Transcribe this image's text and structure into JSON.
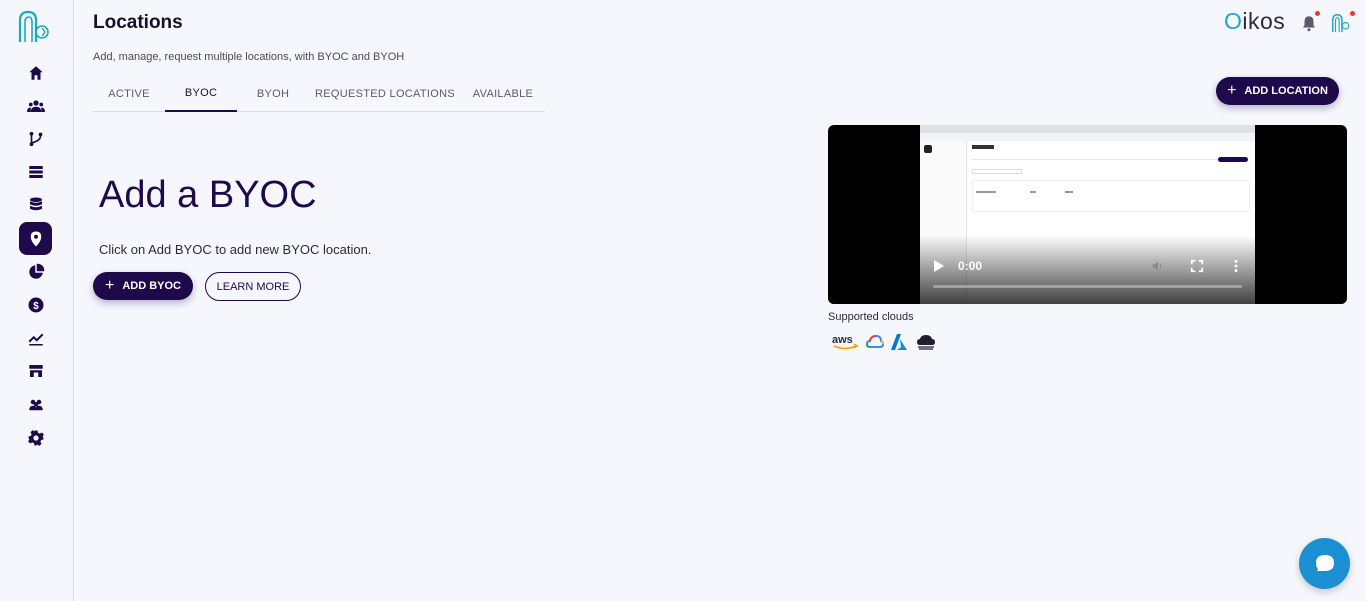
{
  "header": {
    "title": "Locations",
    "subtitle": "Add, manage, request multiple locations, with BYOC and BYOH",
    "brand": "ikos",
    "brand_first": "O"
  },
  "tabs": [
    {
      "label": "ACTIVE",
      "active": false
    },
    {
      "label": "BYOC",
      "active": true
    },
    {
      "label": "BYOH",
      "active": false
    },
    {
      "label": "REQUESTED LOCATIONS",
      "active": false
    },
    {
      "label": "AVAILABLE",
      "active": false
    }
  ],
  "actions": {
    "add_location_label": "ADD LOCATION",
    "add_byoc_label": "ADD BYOC",
    "learn_more_label": "LEARN MORE"
  },
  "empty_state": {
    "heading": "Add a BYOC",
    "hint": "Click on Add BYOC to add new BYOC location."
  },
  "video": {
    "time": "0:00"
  },
  "clouds": {
    "label": "Supported clouds",
    "providers": [
      "aws",
      "google-cloud",
      "azure",
      "oracle-cloud"
    ]
  },
  "sidebar": {
    "items": [
      {
        "icon": "home-icon"
      },
      {
        "icon": "users-icon"
      },
      {
        "icon": "branch-icon"
      },
      {
        "icon": "servers-icon"
      },
      {
        "icon": "database-icon"
      },
      {
        "icon": "location-pin-icon",
        "active": true
      },
      {
        "icon": "pie-chart-icon"
      },
      {
        "icon": "dollar-icon"
      },
      {
        "icon": "trend-icon"
      },
      {
        "icon": "store-icon"
      },
      {
        "icon": "team-icon"
      },
      {
        "icon": "gear-icon"
      }
    ]
  },
  "colors": {
    "primary": "#1e0a4a",
    "brand_accent": "#1aa8c4",
    "chat": "#1a8fd1",
    "notification": "#e5383b"
  }
}
